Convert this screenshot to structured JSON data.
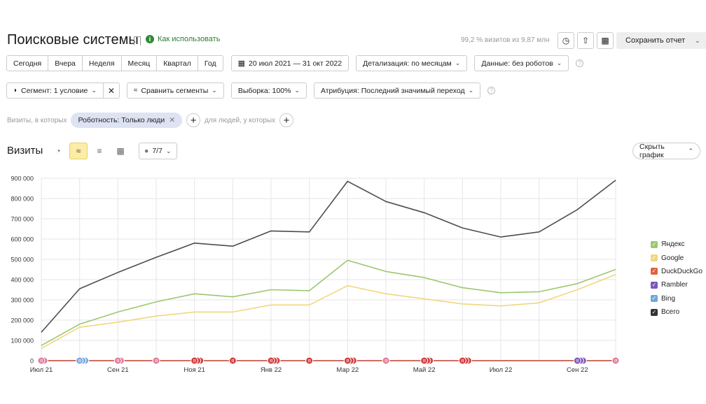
{
  "header": {
    "title": "Поисковые системы",
    "how_to_use": "Как использовать",
    "visits_note": "99,2 % визитов из 9,87 млн",
    "save_report": "Сохранить отчет"
  },
  "period_buttons": [
    "Сегодня",
    "Вчера",
    "Неделя",
    "Месяц",
    "Квартал",
    "Год"
  ],
  "date_range": "20 июл 2021 — 31 окт 2022",
  "detail": "Детализация: по месяцам",
  "data_filter": "Данные: без роботов",
  "segment": "Сегмент: 1 условие",
  "compare": "Сравнить сегменты",
  "sample": "Выборка: 100%",
  "attribution": "Атрибуция: Последний значимый переход",
  "filters": {
    "visits_prefix": "Визиты, в которых",
    "chip": "Роботность: Только люди",
    "people_text": "для людей, у которых"
  },
  "visits_section": {
    "title": "Визиты",
    "series_count": "7/7",
    "hide_chart": "Скрыть график"
  },
  "colors": {
    "total": "#4d4d4d",
    "yandex": "#9cc76f",
    "google": "#f0d77e",
    "duckduckgo": "#e0623f",
    "rambler": "#7f56b8",
    "bing": "#6fa9dc",
    "grid": "#e5e5e5",
    "checkbox_green": "#5a9e3a",
    "checkbox_yellow": "#e9c44a"
  },
  "chart_data": {
    "type": "line",
    "y_tick_labels": [
      "0",
      "100 000",
      "200 000",
      "300 000",
      "400 000",
      "500 000",
      "600 000",
      "700 000",
      "800 000",
      "900 000"
    ],
    "ylim": [
      0,
      900000
    ],
    "x_tick_labels": [
      {
        "label": "Июл 21",
        "i": 0
      },
      {
        "label": "Сен 21",
        "i": 2
      },
      {
        "label": "Ноя 21",
        "i": 4
      },
      {
        "label": "Янв 22",
        "i": 6
      },
      {
        "label": "Мар 22",
        "i": 8
      },
      {
        "label": "Май 22",
        "i": 10
      },
      {
        "label": "Июл 22",
        "i": 12
      },
      {
        "label": "Сен 22",
        "i": 14
      }
    ],
    "x": [
      "2021-07",
      "2021-08",
      "2021-09",
      "2021-10",
      "2021-11",
      "2021-12",
      "2022-01",
      "2022-02",
      "2022-03",
      "2022-04",
      "2022-05",
      "2022-06",
      "2022-07",
      "2022-08",
      "2022-09",
      "2022-10"
    ],
    "series": [
      {
        "name": "Всего",
        "key": "total",
        "values": [
          140000,
          355000,
          435000,
          510000,
          580000,
          565000,
          640000,
          635000,
          885000,
          785000,
          730000,
          655000,
          610000,
          635000,
          745000,
          890000
        ]
      },
      {
        "name": "Яндекс",
        "key": "yandex",
        "values": [
          75000,
          180000,
          240000,
          290000,
          330000,
          315000,
          350000,
          345000,
          495000,
          440000,
          410000,
          360000,
          335000,
          340000,
          380000,
          450000
        ]
      },
      {
        "name": "Google",
        "key": "google",
        "values": [
          60000,
          165000,
          190000,
          220000,
          240000,
          240000,
          275000,
          275000,
          370000,
          330000,
          305000,
          280000,
          270000,
          285000,
          350000,
          425000
        ]
      },
      {
        "name": "DuckDuckGo",
        "key": "duckduckgo",
        "values": [
          0,
          0,
          0,
          0,
          0,
          0,
          0,
          0,
          0,
          0,
          0,
          0,
          0,
          0,
          0,
          0
        ]
      },
      {
        "name": "Rambler",
        "key": "rambler",
        "values": [
          0,
          0,
          0,
          0,
          0,
          0,
          0,
          0,
          0,
          0,
          0,
          0,
          0,
          0,
          0,
          0
        ]
      },
      {
        "name": "Bing",
        "key": "bing",
        "values": [
          0,
          0,
          0,
          0,
          0,
          0,
          0,
          0,
          0,
          0,
          0,
          0,
          0,
          0,
          0,
          0
        ]
      }
    ],
    "legend": [
      {
        "name": "Яндекс",
        "key": "yandex",
        "box": "#9cc76f"
      },
      {
        "name": "Google",
        "key": "google",
        "box": "#f0d77e"
      },
      {
        "name": "DuckDuckGo",
        "key": "duckduckgo",
        "box": "#e0623f"
      },
      {
        "name": "Rambler",
        "key": "rambler",
        "box": "#7f56b8"
      },
      {
        "name": "Bing",
        "key": "bing",
        "box": "#6fa9dc"
      },
      {
        "name": "Всего",
        "key": "total",
        "box": "#333333"
      }
    ],
    "annotation_markers": [
      {
        "i": 0,
        "count": 2,
        "color": "#e07a9a"
      },
      {
        "i": 1,
        "count": 3,
        "color": "#7aa8e0"
      },
      {
        "i": 2,
        "count": 2,
        "color": "#e07a9a"
      },
      {
        "i": 3,
        "count": 1,
        "color": "#e07a9a"
      },
      {
        "i": 4,
        "count": 3,
        "color": "#d23c3c"
      },
      {
        "i": 5,
        "count": 1,
        "color": "#d23c3c"
      },
      {
        "i": 6,
        "count": 3,
        "color": "#d23c3c"
      },
      {
        "i": 7,
        "count": 1,
        "color": "#d23c3c"
      },
      {
        "i": 8,
        "count": 3,
        "color": "#d23c3c"
      },
      {
        "i": 9,
        "count": 1,
        "color": "#e07a9a"
      },
      {
        "i": 10,
        "count": 3,
        "color": "#d23c3c"
      },
      {
        "i": 11,
        "count": 3,
        "color": "#d23c3c"
      },
      {
        "i": 14,
        "count": 3,
        "color": "#7f56b8"
      },
      {
        "i": 15,
        "count": 1,
        "color": "#e07a9a"
      }
    ],
    "marker_letter": "Я",
    "grid": true,
    "legend_placement": "right"
  }
}
